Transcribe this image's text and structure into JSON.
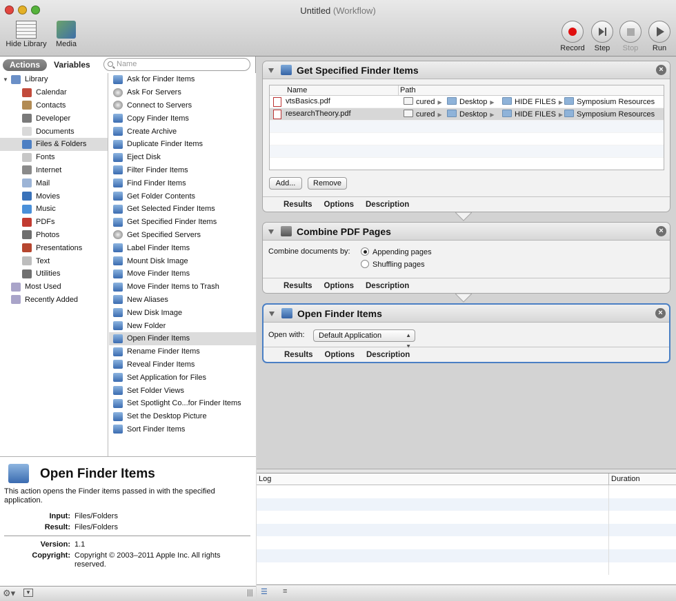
{
  "window": {
    "title": "Untitled",
    "subtitle": "(Workflow)"
  },
  "toolbar": {
    "hide_library": "Hide Library",
    "media": "Media",
    "record": "Record",
    "step": "Step",
    "stop": "Stop",
    "run": "Run"
  },
  "library": {
    "tab_actions": "Actions",
    "tab_variables": "Variables",
    "search_placeholder": "Name",
    "items": [
      {
        "label": "Library",
        "icon": "library-icon",
        "color": "#6a8fc7"
      },
      {
        "label": "Calendar",
        "icon": "calendar-icon",
        "color": "#c24b3c"
      },
      {
        "label": "Contacts",
        "icon": "contacts-icon",
        "color": "#b28b54"
      },
      {
        "label": "Developer",
        "icon": "developer-icon",
        "color": "#7a7a7a"
      },
      {
        "label": "Documents",
        "icon": "documents-icon",
        "color": "#d9d9d9"
      },
      {
        "label": "Files & Folders",
        "icon": "finder-icon",
        "color": "#4d7fc3"
      },
      {
        "label": "Fonts",
        "icon": "fonts-icon",
        "color": "#c7c7c7"
      },
      {
        "label": "Internet",
        "icon": "internet-icon",
        "color": "#8a8a8a"
      },
      {
        "label": "Mail",
        "icon": "mail-icon",
        "color": "#9cb4d6"
      },
      {
        "label": "Movies",
        "icon": "movies-icon",
        "color": "#3a72b9"
      },
      {
        "label": "Music",
        "icon": "music-icon",
        "color": "#4a90d9"
      },
      {
        "label": "PDFs",
        "icon": "pdf-icon",
        "color": "#c23b31"
      },
      {
        "label": "Photos",
        "icon": "photos-icon",
        "color": "#6e6e6e"
      },
      {
        "label": "Presentations",
        "icon": "presentations-icon",
        "color": "#b6462f"
      },
      {
        "label": "Text",
        "icon": "text-icon",
        "color": "#bdbdbd"
      },
      {
        "label": "Utilities",
        "icon": "utilities-icon",
        "color": "#707070"
      },
      {
        "label": "Most Used",
        "icon": "smart-folder-icon",
        "color": "#a9a4c9"
      },
      {
        "label": "Recently Added",
        "icon": "smart-folder-icon",
        "color": "#a9a4c9"
      }
    ],
    "actions": [
      "Ask for Finder Items",
      "Ask For Servers",
      "Connect to Servers",
      "Copy Finder Items",
      "Create Archive",
      "Duplicate Finder Items",
      "Eject Disk",
      "Filter Finder Items",
      "Find Finder Items",
      "Get Folder Contents",
      "Get Selected Finder Items",
      "Get Specified Finder Items",
      "Get Specified Servers",
      "Label Finder Items",
      "Mount Disk Image",
      "Move Finder Items",
      "Move Finder Items to Trash",
      "New Aliases",
      "New Disk Image",
      "New Folder",
      "Open Finder Items",
      "Rename Finder Items",
      "Reveal Finder Items",
      "Set Application for Files",
      "Set Folder Views",
      "Set Spotlight Co...for Finder Items",
      "Set the Desktop Picture",
      "Sort Finder Items"
    ]
  },
  "description": {
    "title": "Open Finder Items",
    "text": "This action opens the Finder items passed in with the specified application.",
    "input_label": "Input:",
    "input_value": "Files/Folders",
    "result_label": "Result:",
    "result_value": "Files/Folders",
    "version_label": "Version:",
    "version_value": "1.1",
    "copyright_label": "Copyright:",
    "copyright_value": "Copyright © 2003–2011 Apple Inc.  All rights reserved."
  },
  "workflow": {
    "card1": {
      "title": "Get Specified Finder Items",
      "col_name": "Name",
      "col_path": "Path",
      "files": [
        {
          "name": "vtsBasics.pdf",
          "path": [
            "cured",
            "Desktop",
            "HIDE FILES",
            "Symposium Resources"
          ]
        },
        {
          "name": "researchTheory.pdf",
          "path": [
            "cured",
            "Desktop",
            "HIDE FILES",
            "Symposium Resources"
          ]
        }
      ],
      "add": "Add...",
      "remove": "Remove"
    },
    "card2": {
      "title": "Combine PDF Pages",
      "label": "Combine documents by:",
      "opt1": "Appending pages",
      "opt2": "Shuffling pages"
    },
    "card3": {
      "title": "Open Finder Items",
      "label": "Open with:",
      "value": "Default Application"
    },
    "footer": {
      "results": "Results",
      "options": "Options",
      "description": "Description"
    }
  },
  "log": {
    "col_log": "Log",
    "col_duration": "Duration"
  },
  "colors": {
    "accent": "#4a7fc4",
    "record": "#e01010"
  }
}
